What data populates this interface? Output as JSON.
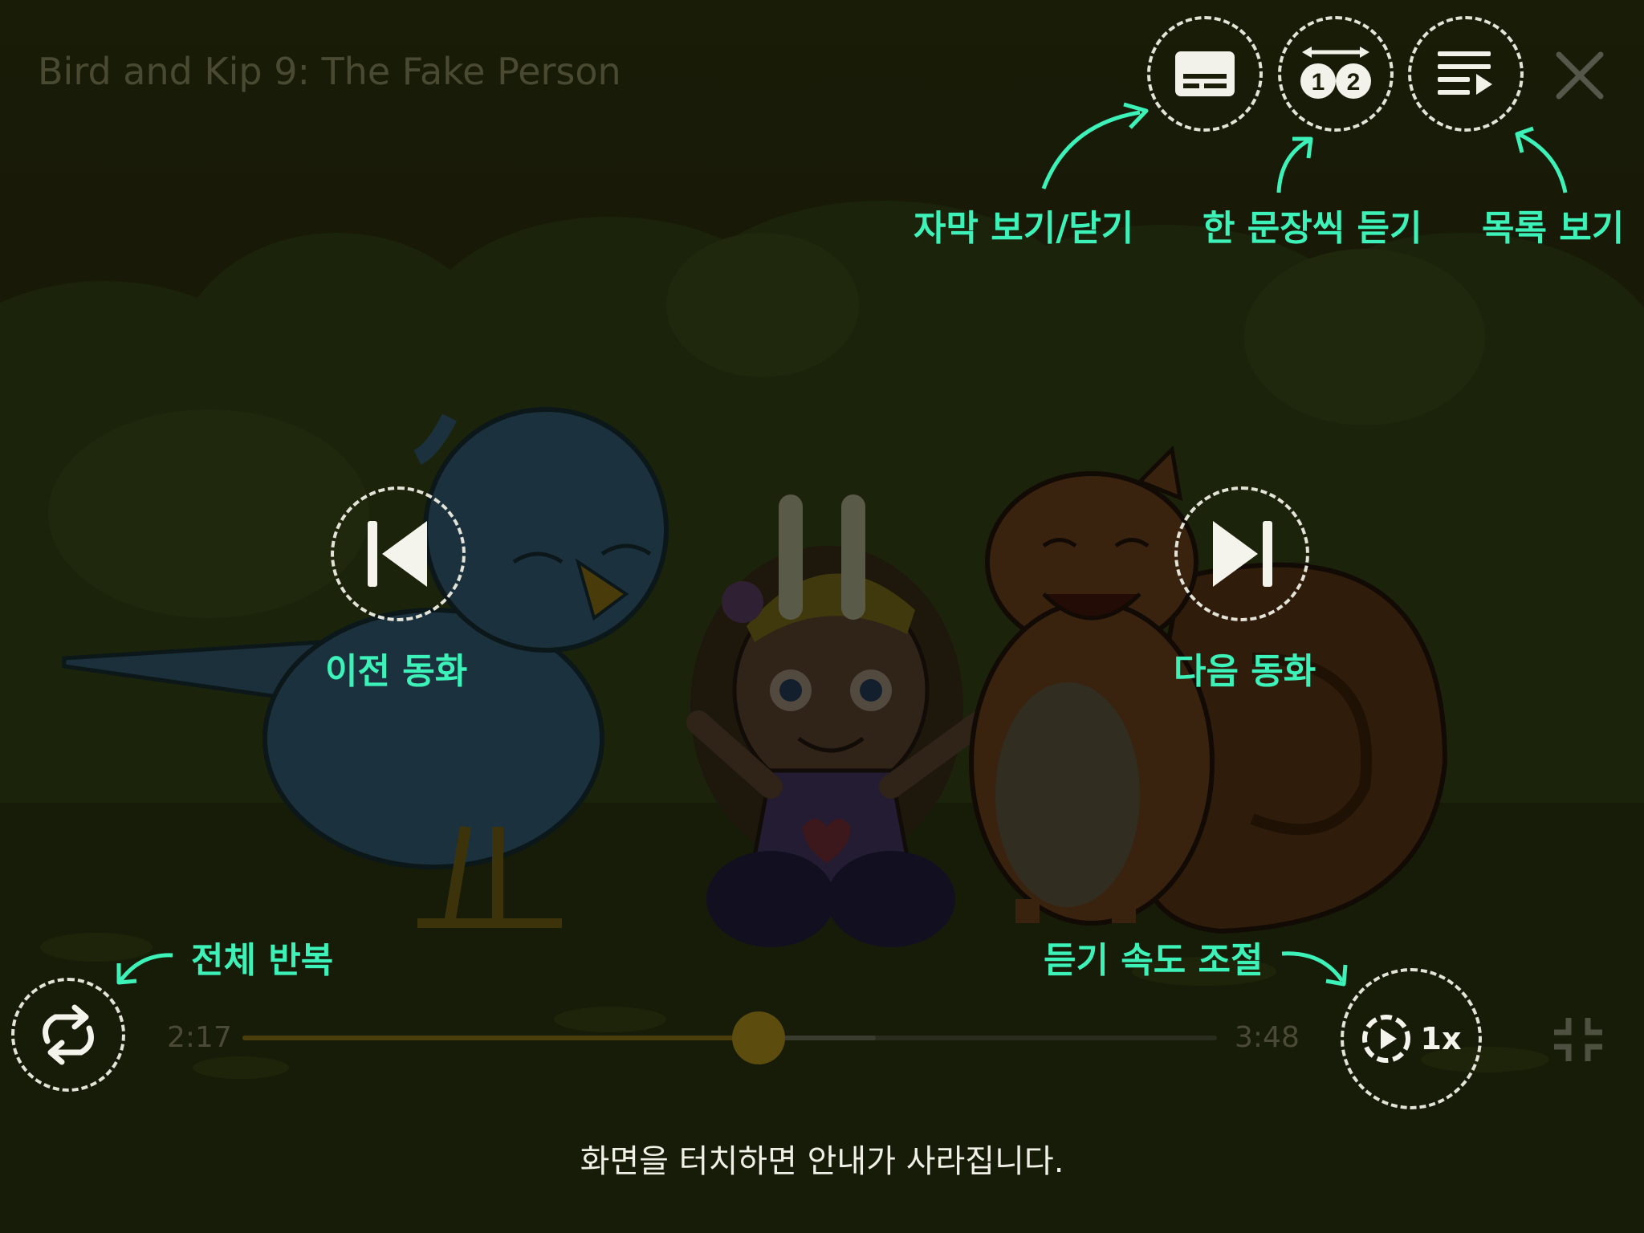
{
  "title": "Bird and Kip 9: The Fake Person",
  "controls": {
    "subtitle_toggle_icon": "subtitles-icon",
    "sentence_mode_icon": "sentence-by-sentence-icon",
    "playlist_icon": "playlist-icon",
    "close_icon": "close-icon",
    "previous_icon": "skip-previous-icon",
    "pause_icon": "pause-icon",
    "next_icon": "skip-next-icon",
    "repeat_icon": "repeat-all-icon",
    "speed_icon": "playback-speed-icon",
    "speed_value": "1x",
    "exit_fullscreen_icon": "exit-fullscreen-icon"
  },
  "hints": {
    "subtitle": "자막 보기/닫기",
    "sentence": "한 문장씩 듣기",
    "playlist": "목록 보기",
    "previous": "이전 동화",
    "next": "다음 동화",
    "repeat": "전체 반복",
    "speed": "듣기 속도 조절"
  },
  "progress": {
    "current_time": "2:17",
    "total_time": "3:48",
    "played_fraction": 0.53,
    "buffered_fraction": 0.65
  },
  "dismiss_message": "화면을 터치하면 안내가 사라집니다.",
  "colors": {
    "hint_green": "#3df2b8",
    "progress_played": "#4a3e0c",
    "progress_thumb": "#5c4c0e",
    "overlay_dark": "#1a1d08"
  }
}
